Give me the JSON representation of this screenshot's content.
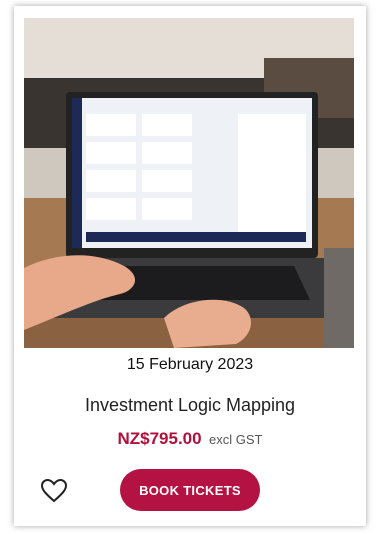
{
  "event": {
    "date": "15 February 2023",
    "title": "Investment Logic Mapping",
    "price": "NZ$795.00",
    "tax_note": "excl GST"
  },
  "actions": {
    "favorite_icon": "heart-outline-icon",
    "book_label": "BOOK TICKETS"
  },
  "colors": {
    "accent": "#b31242",
    "price": "#b0103c"
  }
}
